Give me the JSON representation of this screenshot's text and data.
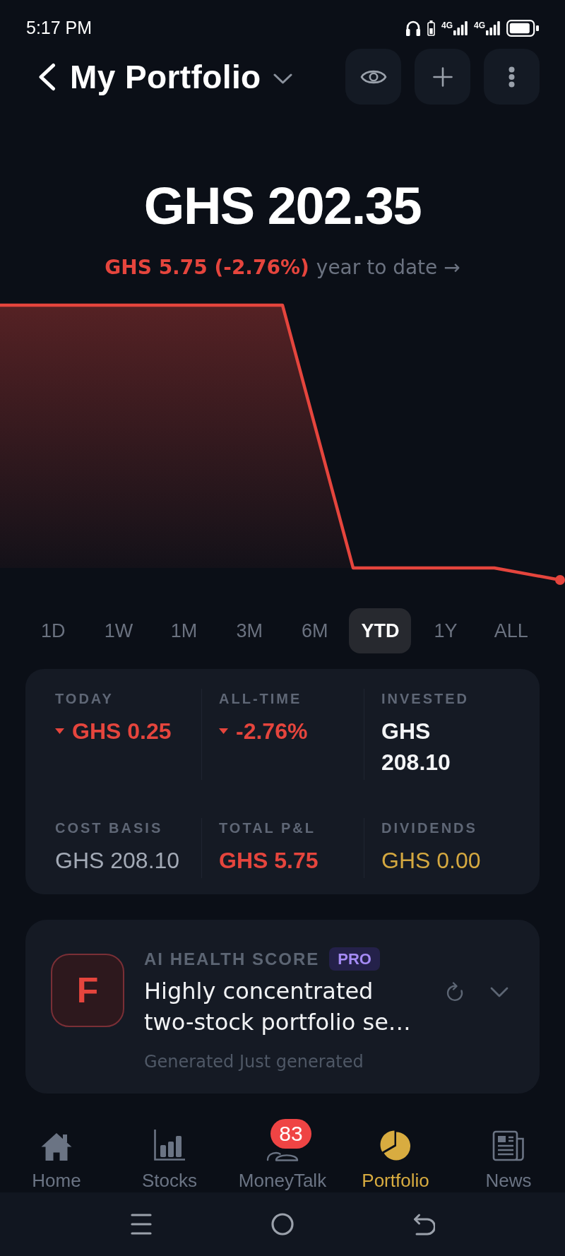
{
  "status_bar": {
    "time": "5:17 PM",
    "networks": [
      {
        "label": "4G"
      },
      {
        "label": "4G"
      }
    ]
  },
  "header": {
    "title": "My Portfolio"
  },
  "summary": {
    "value": "GHS 202.35",
    "change": "GHS 5.75 (-2.76%)",
    "period": "year to date →",
    "negative": true
  },
  "ranges": [
    {
      "label": "1D",
      "selected": false
    },
    {
      "label": "1W",
      "selected": false
    },
    {
      "label": "1M",
      "selected": false
    },
    {
      "label": "3M",
      "selected": false
    },
    {
      "label": "6M",
      "selected": false
    },
    {
      "label": "YTD",
      "selected": true
    },
    {
      "label": "1Y",
      "selected": false
    },
    {
      "label": "ALL",
      "selected": false
    }
  ],
  "stats": [
    {
      "label": "TODAY",
      "value": "GHS 0.25",
      "kind": "change",
      "negative": true
    },
    {
      "label": "ALL-TIME",
      "value": "-2.76%",
      "kind": "change",
      "negative": true
    },
    {
      "label": "INVESTED",
      "value": "GHS 208.10",
      "kind": "amount",
      "negative": false
    },
    {
      "label": "COST BASIS",
      "value": "GHS 208.10",
      "kind": "basis",
      "negative": false
    },
    {
      "label": "TOTAL P&L",
      "value": "GHS 5.75",
      "kind": "total",
      "negative": true
    },
    {
      "label": "DIVIDENDS",
      "value": "GHS 0.00",
      "kind": "dividend",
      "negative": false
    }
  ],
  "health": {
    "grade": "F",
    "title": "AI HEALTH SCORE",
    "badge": "PRO",
    "summary": "Highly concentrated two-stock portfolio se…",
    "meta": "Generated Just generated",
    "expanded": false
  },
  "nav": {
    "items": [
      {
        "label": "Home",
        "selected": false
      },
      {
        "label": "Stocks",
        "selected": false
      },
      {
        "label": "MoneyTalk",
        "selected": false,
        "badge": "83"
      },
      {
        "label": "Portfolio",
        "selected": true
      },
      {
        "label": "News",
        "selected": false
      }
    ]
  }
}
